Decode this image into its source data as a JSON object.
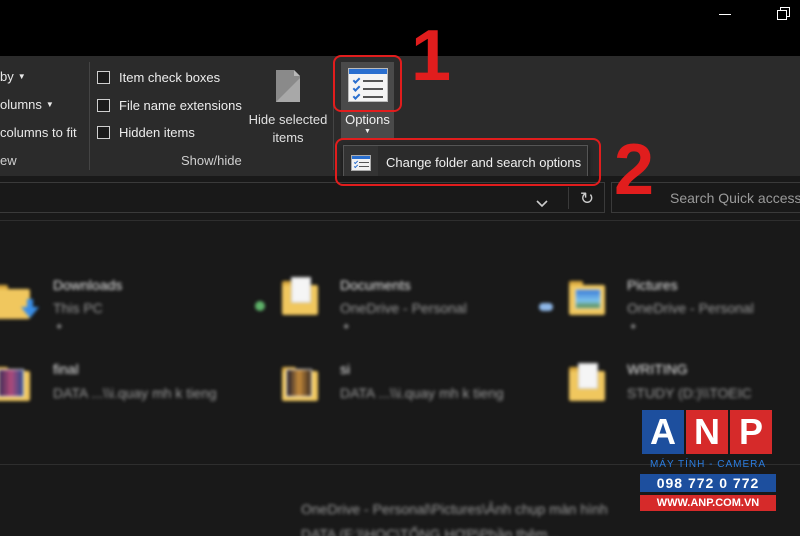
{
  "window": {
    "controls": [
      "minimize-icon",
      "restore-icon"
    ]
  },
  "ribbon": {
    "layout_group": {
      "items": [
        {
          "label": "by",
          "has_caret": true
        },
        {
          "label": "olumns",
          "has_caret": true
        },
        {
          "label": "columns to fit",
          "has_caret": false
        }
      ],
      "group_label": "ew"
    },
    "show_hide": {
      "checkboxes": [
        {
          "label": "Item check boxes",
          "checked": false
        },
        {
          "label": "File name extensions",
          "checked": false
        },
        {
          "label": "Hidden items",
          "checked": false
        }
      ],
      "hide_selected_line1": "Hide selected",
      "hide_selected_line2": "items",
      "group_label": "Show/hide"
    },
    "options_label": "Options"
  },
  "dropdown": {
    "item_label": "Change folder and search options"
  },
  "address_bar": {
    "search_placeholder": "Search Quick access"
  },
  "quick_access": {
    "items": [
      {
        "title": "Downloads",
        "sub": "This PC",
        "pinned": true
      },
      {
        "title": "Documents",
        "sub": "OneDrive - Personal",
        "pinned": true
      },
      {
        "title": "Pictures",
        "sub": "OneDrive - Personal",
        "pinned": true
      },
      {
        "title": "final",
        "sub": "DATA ...\\\\i.quay mh k tieng",
        "pinned": false
      },
      {
        "title": "si",
        "sub": "DATA ...\\\\i.quay mh k tieng",
        "pinned": false
      },
      {
        "title": "WRITING",
        "sub": "STUDY (D:)\\\\TOEIC",
        "pinned": false
      }
    ],
    "recent_path": "OneDrive - Personal\\Pictures\\Ảnh chụp màn hình",
    "recent_path2": "DATA (F:)\\HỌC\\TỔNG HỢP\\Phần thêm..."
  },
  "annotations": {
    "step1": "1",
    "step2": "2",
    "color": "#e11d1d"
  },
  "watermark": {
    "letters": [
      "A",
      "N",
      "P"
    ],
    "tile_colors": [
      "#1d4f9e",
      "#d62a2a",
      "#d62a2a"
    ],
    "tagline": "MÁY TÍNH - CAMERA",
    "phone": "098 772 0 772",
    "website": "WWW.ANP.COM.VN"
  }
}
